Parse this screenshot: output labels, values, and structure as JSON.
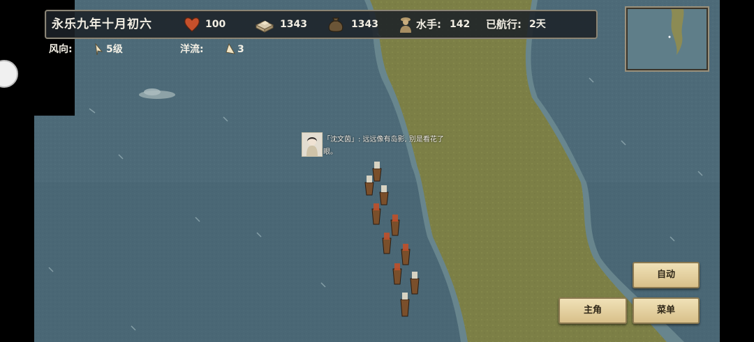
{
  "hud": {
    "date": "永乐九年十月初六",
    "health": "100",
    "supplies": "1343",
    "gold": "1343",
    "sailors_label": "水手:",
    "sailors": "142",
    "sailed_label": "已航行:",
    "sailed_days": "2天"
  },
  "conditions": {
    "wind_label": "风向:",
    "wind_value": "5级",
    "current_label": "洋流:",
    "current_value": "3"
  },
  "dialog": {
    "text": "「沈文茵」: 远远像有岛影, 别是看花了眼。"
  },
  "buttons": {
    "auto": "自动",
    "protagonist": "主角",
    "menu": "菜单"
  },
  "icons": {
    "health": "heart-icon",
    "supplies": "crate-icon",
    "gold": "money-bag-icon",
    "sailors": "sailor-icon",
    "wind": "wind-arrow-icon",
    "current": "current-arrow-icon"
  }
}
